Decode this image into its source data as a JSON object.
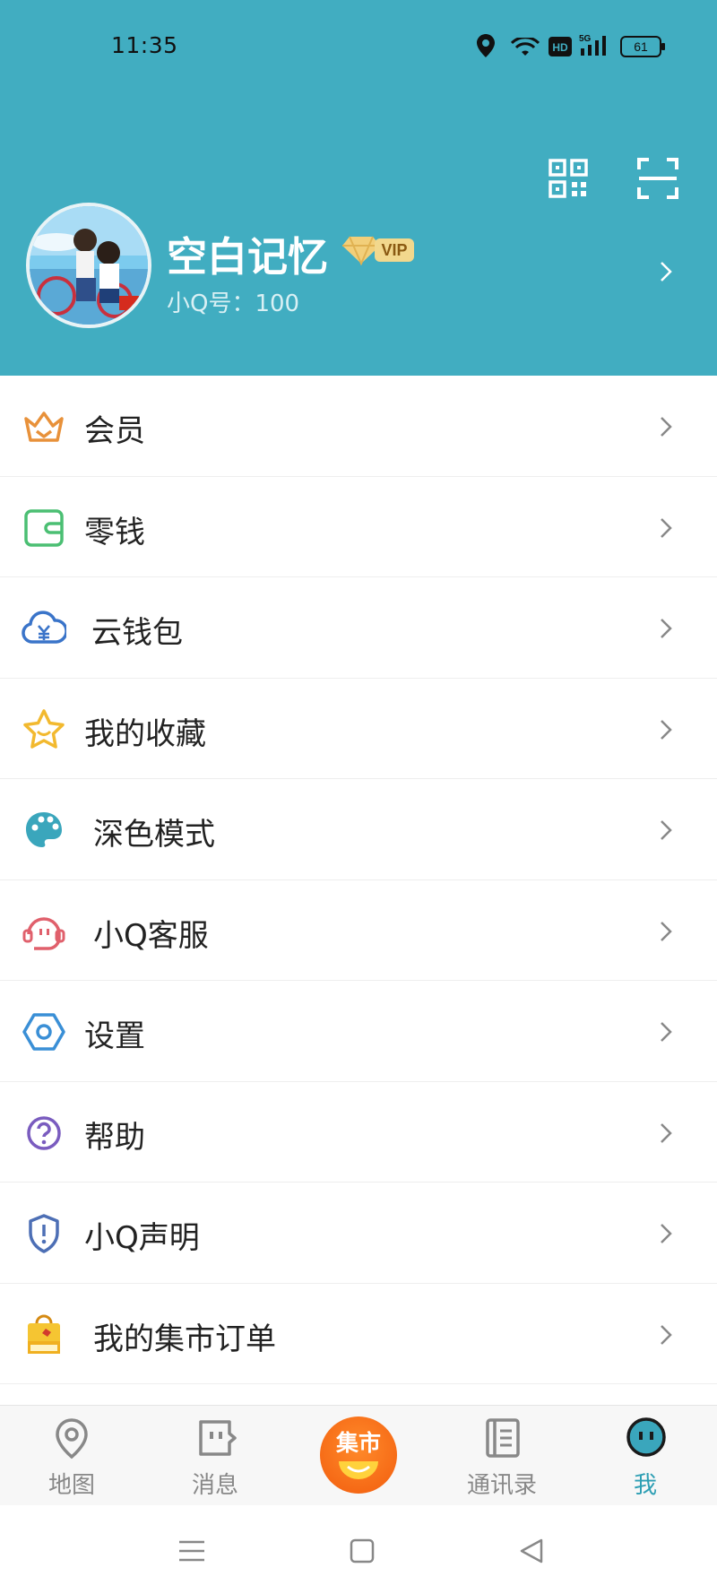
{
  "status_bar": {
    "time": "11:35",
    "battery": "61",
    "icons": [
      "location-icon",
      "wifi-icon",
      "hd-icon",
      "5g-signal-icon",
      "battery-icon"
    ]
  },
  "header": {
    "background_color": "#41adc1",
    "profile": {
      "name": "空白记忆",
      "vip_label": "VIP",
      "qq_number": "小Q号：100"
    },
    "actions": [
      "qr-code-icon",
      "scan-icon"
    ]
  },
  "menu": {
    "items": [
      {
        "label": "会员",
        "icon": "crown-icon",
        "color": "#e8913a"
      },
      {
        "label": "零钱",
        "icon": "wallet-icon",
        "color": "#4bbf73"
      },
      {
        "label": "云钱包",
        "icon": "cloud-wallet-icon",
        "color": "#3a74c9"
      },
      {
        "label": "我的收藏",
        "icon": "star-icon",
        "color": "#f2b92f"
      },
      {
        "label": "深色模式",
        "icon": "palette-icon",
        "color": "#3aa6bc"
      },
      {
        "label": "小Q客服",
        "icon": "customer-service-icon",
        "color": "#e0606c"
      },
      {
        "label": "设置",
        "icon": "settings-hexagon-icon",
        "color": "#3a8fd6"
      },
      {
        "label": "帮助",
        "icon": "help-icon",
        "color": "#7a5cbf"
      },
      {
        "label": "小Q声明",
        "icon": "shield-icon",
        "color": "#4d6fb5"
      },
      {
        "label": "我的集市订单",
        "icon": "market-bag-icon",
        "color": "#f5c532"
      }
    ]
  },
  "bottom_nav": {
    "items": [
      {
        "label": "地图",
        "icon": "map-pin-icon"
      },
      {
        "label": "消息",
        "icon": "message-icon"
      },
      {
        "label": "集市",
        "icon": "market-icon"
      },
      {
        "label": "通讯录",
        "icon": "contacts-icon"
      },
      {
        "label": "我",
        "icon": "profile-face-icon",
        "active": true
      }
    ],
    "active_color": "#2e9fb4"
  },
  "system_nav": [
    "menu-icon",
    "home-icon",
    "back-icon"
  ]
}
